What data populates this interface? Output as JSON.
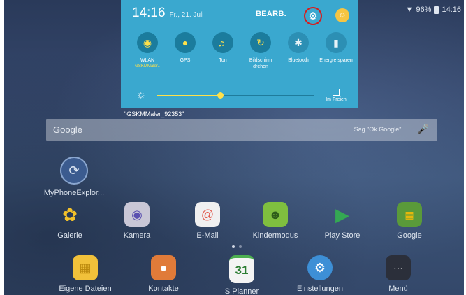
{
  "status_bar": {
    "battery": "96%",
    "time": "14:16"
  },
  "quick_settings": {
    "time": "14:16",
    "date": "Fr., 21. Juli",
    "edit_label": "BEARB.",
    "tiles": [
      {
        "label": "WLAN",
        "sub": "GSKMMaler..",
        "icon": "wifi-icon"
      },
      {
        "label": "GPS",
        "sub": "",
        "icon": "location-icon"
      },
      {
        "label": "Ton",
        "sub": "",
        "icon": "sound-icon"
      },
      {
        "label": "Bildschirm drehen",
        "sub": "",
        "icon": "rotate-icon"
      },
      {
        "label": "Bluetooth",
        "sub": "",
        "icon": "bluetooth-icon"
      },
      {
        "label": "Energie sparen",
        "sub": "",
        "icon": "battery-saver-icon"
      }
    ],
    "brightness_level": 0.4,
    "outdoor_label": "Im Freien"
  },
  "ssid_tooltip": "\"GSKMMaler_92353\"",
  "search": {
    "logo": "Google",
    "hint": "Sag \"Ok Google\"..."
  },
  "apps": {
    "myphoneexplorer": "MyPhoneExplor...",
    "galerie": "Galerie",
    "kamera": "Kamera",
    "email": "E-Mail",
    "kindermodus": "Kindermodus",
    "playstore": "Play Store",
    "google": "Google",
    "eigene_dateien": "Eigene Dateien",
    "kontakte": "Kontakte",
    "splanner": "S Planner",
    "splanner_date": "31",
    "einstellungen": "Einstellungen",
    "menu": "Menü"
  },
  "colors": {
    "panel": "#3aa8cf",
    "accent_yellow": "#ffe14a",
    "highlight_circle": "#d61d1d"
  }
}
